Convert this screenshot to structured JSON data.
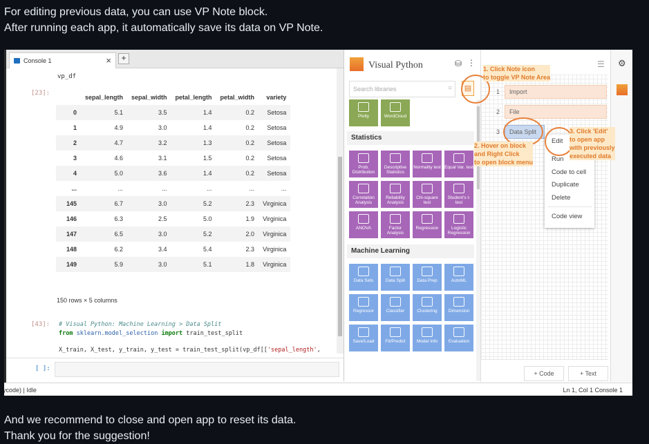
{
  "intro": {
    "line1": "For editing previous data, you can use VP Note block.",
    "line2": "After running each app, it automatically save its data on VP Note."
  },
  "outro": {
    "line1": "And we recommend to close and open app to reset its data.",
    "line2": "Thank you for the suggestion!"
  },
  "console": {
    "tab_label": "Console 1",
    "tab_close": "×",
    "tab_add": "+",
    "vp_df": "vp_df",
    "prompt_23": "[23]:",
    "prompt_43": "[43]:",
    "input_prompt": "[ ]:",
    "dataframe": {
      "columns": [
        "",
        "sepal_length",
        "sepal_width",
        "petal_length",
        "petal_width",
        "variety"
      ],
      "rows": [
        [
          "0",
          "5.1",
          "3.5",
          "1.4",
          "0.2",
          "Setosa"
        ],
        [
          "1",
          "4.9",
          "3.0",
          "1.4",
          "0.2",
          "Setosa"
        ],
        [
          "2",
          "4.7",
          "3.2",
          "1.3",
          "0.2",
          "Setosa"
        ],
        [
          "3",
          "4.6",
          "3.1",
          "1.5",
          "0.2",
          "Setosa"
        ],
        [
          "4",
          "5.0",
          "3.6",
          "1.4",
          "0.2",
          "Setosa"
        ],
        [
          "...",
          "...",
          "...",
          "...",
          "...",
          "..."
        ],
        [
          "145",
          "6.7",
          "3.0",
          "5.2",
          "2.3",
          "Virginica"
        ],
        [
          "146",
          "6.3",
          "2.5",
          "5.0",
          "1.9",
          "Virginica"
        ],
        [
          "147",
          "6.5",
          "3.0",
          "5.2",
          "2.0",
          "Virginica"
        ],
        [
          "148",
          "6.2",
          "3.4",
          "5.4",
          "2.3",
          "Virginica"
        ],
        [
          "149",
          "5.9",
          "3.0",
          "5.1",
          "1.8",
          "Virginica"
        ]
      ],
      "shape_text": "150 rows × 5 columns"
    },
    "code_comment": "# Visual Python: Machine Learning > Data Split",
    "code_from": "from",
    "code_module": "sklearn.model_selection",
    "code_import": "import",
    "code_name": "train_test_split",
    "code_line3_a": "X_train, X_test, y_train, y_test = train_test_split(vp_df[[",
    "code_line3_str": "'sepal_length'",
    "code_line3_b": ","
  },
  "statusbar": {
    "left": "ycode) | Idle",
    "right": "Ln 1, Col 1     Console 1"
  },
  "visual_python": {
    "title": "Visual Python",
    "search_placeholder": "Search libraries",
    "top_tiles": [
      {
        "label": "Plotly"
      },
      {
        "label": "WordCloud"
      }
    ],
    "statistics_title": "Statistics",
    "statistics_tiles": [
      {
        "label": "Prob. Distribution"
      },
      {
        "label": "Descriptive Statistics"
      },
      {
        "label": "Normality test"
      },
      {
        "label": "Equal Var. test"
      },
      {
        "label": "Correlation Analysis"
      },
      {
        "label": "Reliability Analysis"
      },
      {
        "label": "Chi-square test"
      },
      {
        "label": "Student's t-test"
      },
      {
        "label": "ANOVA"
      },
      {
        "label": "Factor Analysis"
      },
      {
        "label": "Regression"
      },
      {
        "label": "Logistic Regression"
      }
    ],
    "ml_title": "Machine Learning",
    "ml_tiles": [
      {
        "label": "Data Sets"
      },
      {
        "label": "Data Split"
      },
      {
        "label": "Data Prep"
      },
      {
        "label": "AutoML"
      },
      {
        "label": "Regressor"
      },
      {
        "label": "Classifier"
      },
      {
        "label": "Clustering"
      },
      {
        "label": "Dimension"
      },
      {
        "label": "Save/Load"
      },
      {
        "label": "Fit/Predict"
      },
      {
        "label": "Model Info"
      },
      {
        "label": "Evaluation"
      }
    ]
  },
  "notes": {
    "blocks": [
      {
        "num": "1",
        "label": "Import"
      },
      {
        "num": "2",
        "label": "File"
      },
      {
        "num": "3",
        "label": "Data Split"
      }
    ],
    "add_code": "+ Code",
    "add_text": "+ Text"
  },
  "context_menu": {
    "edit": "Edit",
    "run": "Run",
    "code_to_cell": "Code to cell",
    "duplicate": "Duplicate",
    "delete": "Delete",
    "code_view": "Code view"
  },
  "annotations": {
    "a1_line1": "1. Click Note icon",
    "a1_line2": "to toggle VP Note Area",
    "a2_line1": "2. Hover on block",
    "a2_line2": "and Right Click",
    "a2_line3": "to open block menu",
    "a3_line1": "3. Click 'Edit'",
    "a3_line2": "to open app",
    "a3_line3": "with previously",
    "a3_line4": "executed data"
  },
  "colors": {
    "accent_orange": "#e8813a",
    "statistics_tile": "#a766b8",
    "ml_tile": "#7fa9e6",
    "viz_tile": "#8aa855",
    "note_block": "#fbe5d6",
    "selected_block": "#c8d8ef"
  }
}
